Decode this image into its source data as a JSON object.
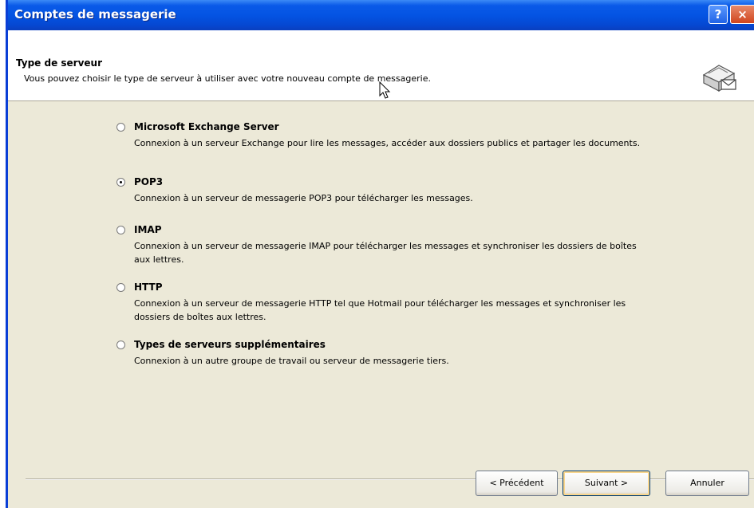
{
  "window": {
    "title": "Comptes de messagerie",
    "help_glyph": "?",
    "close_glyph": "×"
  },
  "header": {
    "title": "Type de serveur",
    "subtitle": "Vous pouvez choisir le type de serveur à utiliser avec votre nouveau compte de messagerie."
  },
  "options": [
    {
      "label": "Microsoft Exchange Server",
      "desc": "Connexion à un serveur Exchange pour lire les messages, accéder aux dossiers publics et partager les documents.",
      "checked": false
    },
    {
      "label": "POP3",
      "desc": "Connexion à un serveur de messagerie POP3 pour télécharger les messages.",
      "checked": true
    },
    {
      "label": "IMAP",
      "desc": "Connexion à un serveur de messagerie IMAP pour télécharger les messages et synchroniser les dossiers de boîtes aux lettres.",
      "checked": false
    },
    {
      "label": "HTTP",
      "desc": "Connexion à un serveur de messagerie HTTP tel que Hotmail pour télécharger les messages et synchroniser les dossiers de boîtes aux lettres.",
      "checked": false
    },
    {
      "label": "Types de serveurs supplémentaires",
      "desc": "Connexion à un autre groupe de travail ou serveur de messagerie tiers.",
      "checked": false
    }
  ],
  "buttons": {
    "back": "< Précédent",
    "next": "Suivant >",
    "cancel": "Annuler"
  }
}
